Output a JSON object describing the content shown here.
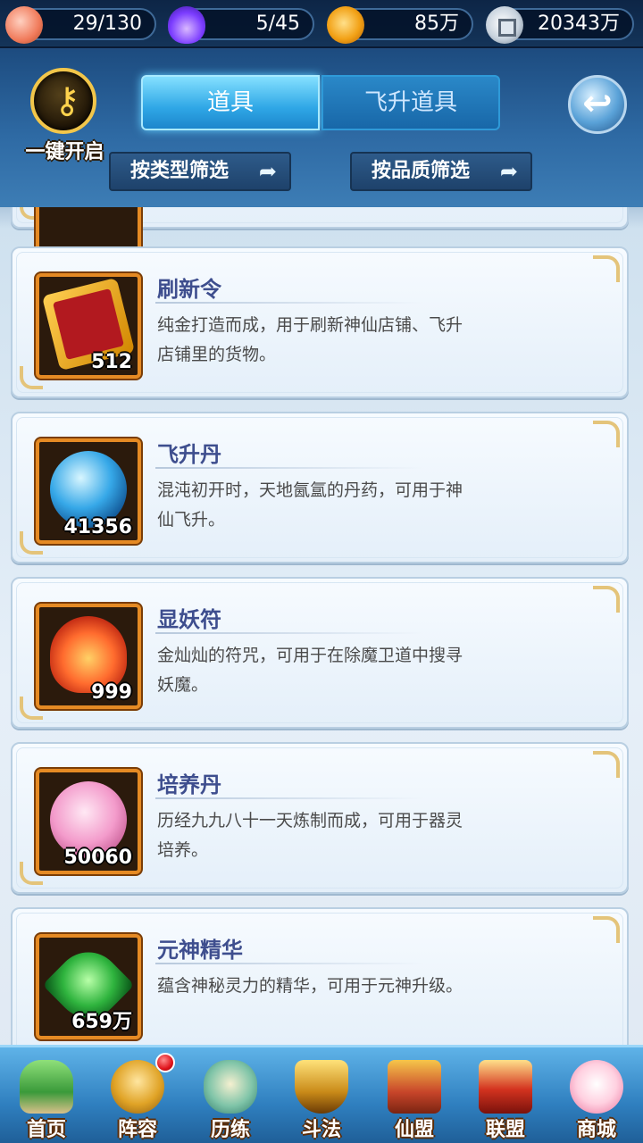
{
  "resources": {
    "peach": {
      "icon": "peach-icon",
      "value": "29/130"
    },
    "spirit": {
      "icon": "purple-flame-icon",
      "value": "5/45"
    },
    "gold": {
      "icon": "gold-coin-icon",
      "value": "85万"
    },
    "silver": {
      "icon": "silver-coin-icon",
      "value": "20343万"
    }
  },
  "header": {
    "one_key_open": "一键开启",
    "tabs": [
      {
        "label": "道具",
        "active": true
      },
      {
        "label": "飞升道具",
        "active": false
      }
    ],
    "filters": {
      "by_type": "按类型筛选",
      "by_quality": "按品质筛选"
    }
  },
  "items": [
    {
      "name": "刷新令",
      "count": "512",
      "icon": "refresh-token-icon",
      "desc": "纯金打造而成，用于刷新神仙店铺、飞升店铺里的货物。"
    },
    {
      "name": "飞升丹",
      "count": "41356",
      "icon": "ascension-orb-icon",
      "desc": "混沌初开时，天地氤氲的丹药，可用于神仙飞升。"
    },
    {
      "name": "显妖符",
      "count": "999",
      "icon": "demon-charm-icon",
      "desc": "金灿灿的符咒，可用于在除魔卫道中搜寻妖魔。"
    },
    {
      "name": "培养丹",
      "count": "50060",
      "icon": "cultivation-pill-icon",
      "desc": "历经九九八十一天炼制而成，可用于器灵培养。"
    },
    {
      "name": "元神精华",
      "count": "659万",
      "icon": "spirit-essence-icon",
      "desc": "蕴含神秘灵力的精华，可用于元神升级。"
    }
  ],
  "nav": [
    {
      "label": "首页"
    },
    {
      "label": "阵容",
      "badge": true
    },
    {
      "label": "历练"
    },
    {
      "label": "斗法"
    },
    {
      "label": "仙盟"
    },
    {
      "label": "联盟"
    },
    {
      "label": "商城"
    }
  ],
  "colors": {
    "tab_active": "#2fa7e6",
    "item_name": "#3e4e8e",
    "icon_frame": "#e58a24"
  }
}
